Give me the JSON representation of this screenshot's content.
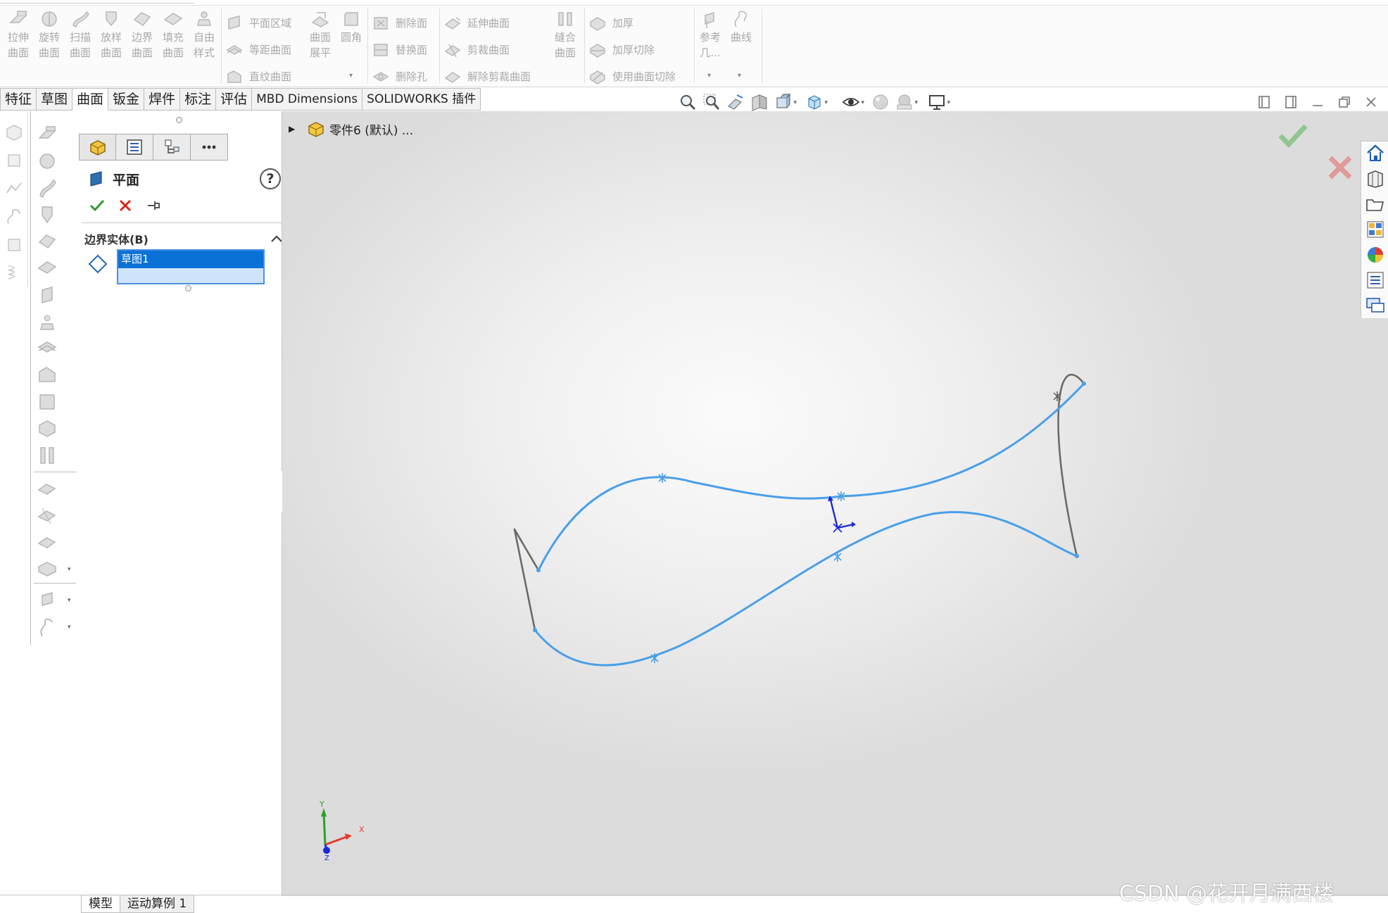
{
  "ribbon": {
    "big_tools": [
      {
        "icon": "extrude-surface-icon",
        "line1": "拉伸",
        "line2": "曲面"
      },
      {
        "icon": "revolve-surface-icon",
        "line1": "旋转",
        "line2": "曲面"
      },
      {
        "icon": "sweep-surface-icon",
        "line1": "扫描",
        "line2": "曲面"
      },
      {
        "icon": "loft-surface-icon",
        "line1": "放样",
        "line2": "曲面"
      },
      {
        "icon": "boundary-surface-icon",
        "line1": "边界",
        "line2": "曲面"
      },
      {
        "icon": "fill-surface-icon",
        "line1": "填充",
        "line2": "曲面"
      },
      {
        "icon": "freeform-icon",
        "line1": "自由",
        "line2": "样式"
      }
    ],
    "col1": [
      "平面区域",
      "等距曲面",
      "直纹曲面"
    ],
    "flatten": {
      "line1": "曲面",
      "line2": "展平"
    },
    "fillet": {
      "line1": "圆角"
    },
    "col2": [
      "删除面",
      "替换面",
      "删除孔"
    ],
    "col3": [
      "延伸曲面",
      "剪裁曲面",
      "解除剪裁曲面"
    ],
    "knit": {
      "line1": "缝合",
      "line2": "曲面"
    },
    "col4": [
      "加厚",
      "加厚切除",
      "使用曲面切除"
    ],
    "refgeom": {
      "line1": "参考",
      "line2": "几..."
    },
    "curves": {
      "line1": "曲线"
    }
  },
  "command_tabs": [
    "特征",
    "草图",
    "曲面",
    "钣金",
    "焊件",
    "标注",
    "评估",
    "MBD Dimensions",
    "SOLIDWORKS 插件"
  ],
  "active_command_tab": "曲面",
  "property_manager": {
    "title": "平面",
    "help": "?",
    "group_title": "边界实体(B)",
    "selected_item": "草图1"
  },
  "feature_tree": {
    "part_label": "零件6 (默认) ..."
  },
  "bottom_tabs": [
    "模型",
    "运动算例 1"
  ],
  "triad": {
    "x": "X",
    "y": "Y",
    "z": "Z"
  },
  "watermark": "CSDN @花开月满西楼",
  "colors": {
    "sketch_selected": "#4a9fe8",
    "sketch_unselected": "#6b6b6b",
    "accept_green": "#3a9a3a",
    "cancel_red": "#d9281c",
    "selection_blue": "#0a71d6"
  }
}
